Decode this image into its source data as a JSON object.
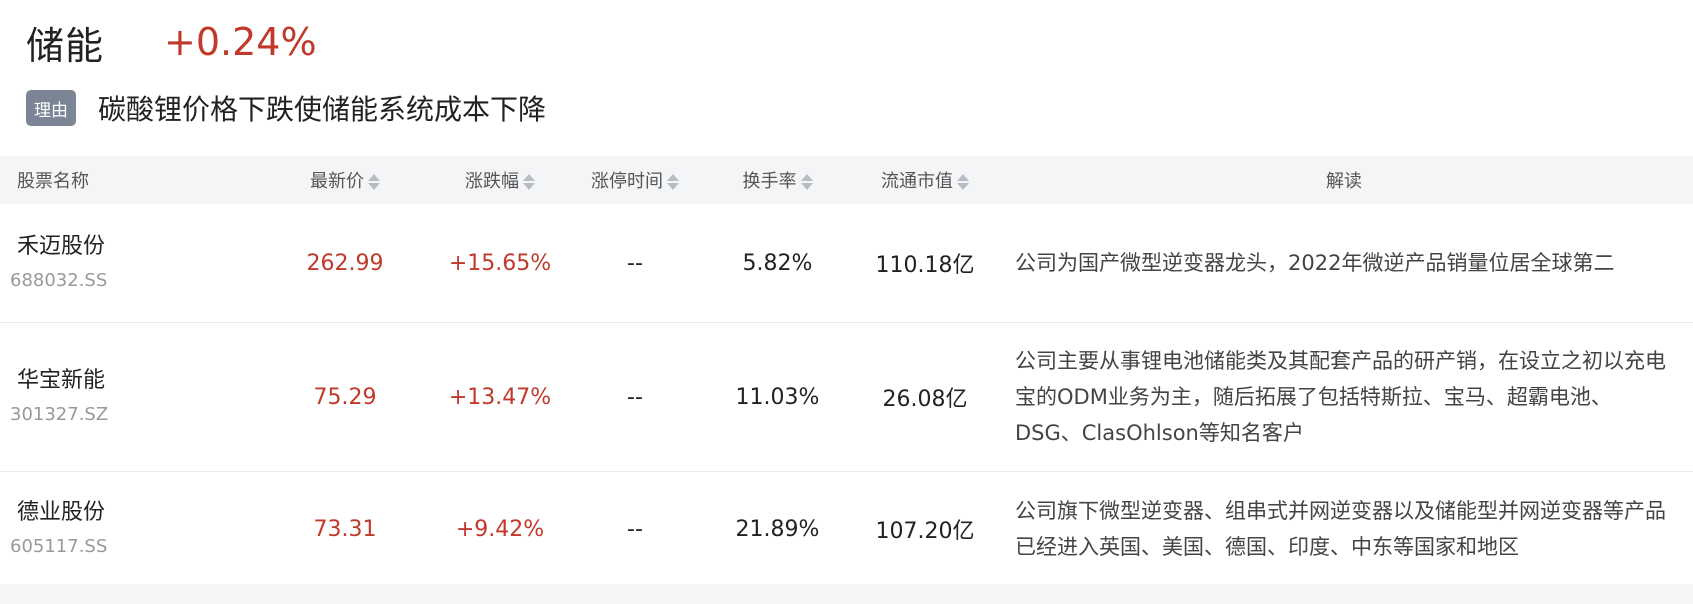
{
  "sector": {
    "name": "储能",
    "change": "+0.24%"
  },
  "reason": {
    "badge_label": "理由",
    "text": "碳酸锂价格下跌使储能系统成本下降"
  },
  "colors": {
    "up_red": "#c0392b",
    "badge_bg": "#7c8596",
    "header_bg": "#f4f5f7"
  },
  "table": {
    "headers": [
      "股票名称",
      "最新价",
      "涨跌幅",
      "涨停时间",
      "换手率",
      "流通市值",
      "解读"
    ],
    "sortable_icon": "sort-caret-icon",
    "rows": [
      {
        "name": "禾迈股份",
        "code": "688032.SS",
        "price": "262.99",
        "change": "+15.65%",
        "limit_time": "--",
        "turnover": "5.82%",
        "market_cap": "110.18亿",
        "description": "公司为国产微型逆变器龙头，2022年微逆产品销量位居全球第二"
      },
      {
        "name": "华宝新能",
        "code": "301327.SZ",
        "price": "75.29",
        "change": "+13.47%",
        "limit_time": "--",
        "turnover": "11.03%",
        "market_cap": "26.08亿",
        "description": "公司主要从事锂电池储能类及其配套产品的研产销，在设立之初以充电宝的ODM业务为主，随后拓展了包括特斯拉、宝马、超霸电池、DSG、ClasOhlson等知名客户"
      },
      {
        "name": "德业股份",
        "code": "605117.SS",
        "price": "73.31",
        "change": "+9.42%",
        "limit_time": "--",
        "turnover": "21.89%",
        "market_cap": "107.20亿",
        "description": "公司旗下微型逆变器、组串式并网逆变器以及储能型并网逆变器等产品已经进入英国、美国、德国、印度、中东等国家和地区"
      }
    ]
  }
}
